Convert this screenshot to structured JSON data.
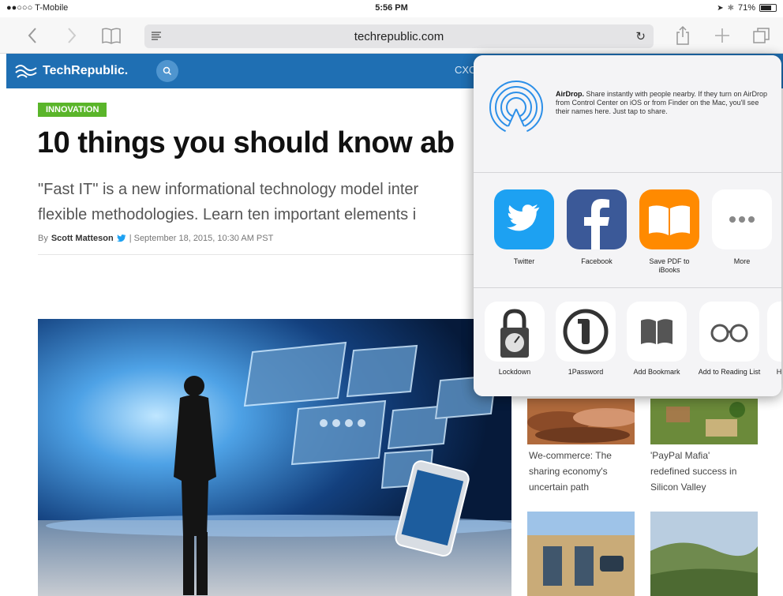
{
  "status_bar": {
    "carrier": "●●○○○ T-Mobile",
    "time": "5:56 PM",
    "battery": "71%",
    "battery_level": 0.71
  },
  "toolbar": {
    "url": "techrepublic.com",
    "icons": [
      "back-icon",
      "forward-icon",
      "bookmarks-icon",
      "reader-icon",
      "reload-icon",
      "share-icon",
      "new-tab-icon",
      "tabs-icon"
    ]
  },
  "site": {
    "logo": "TechRepublic.",
    "nav_partial": "CXO"
  },
  "article": {
    "category": "INNOVATION",
    "headline": "10 things you should know ab",
    "dek_line1": "\"Fast IT\" is a new informational technology model inter",
    "dek_line2": "flexible methodologies. Learn ten important elements i",
    "byline_prefix": "By",
    "author": "Scott Matteson",
    "date": "| September 18, 2015, 10:30 AM PST"
  },
  "side_cards": [
    {
      "title_l1": "We-commerce: The",
      "title_l2": "sharing economy's",
      "title_l3": "uncertain path"
    },
    {
      "title_l1": "'PayPal Mafia'",
      "title_l2": "redefined success in",
      "title_l3": "Silicon Valley"
    }
  ],
  "share_sheet": {
    "airdrop_title": "AirDrop.",
    "airdrop_body": " Share instantly with people nearby. If they turn on AirDrop from Control Center on iOS or from Finder on the Mac, you'll see their names here. Just tap to share.",
    "apps": [
      {
        "label": "Twitter"
      },
      {
        "label": "Facebook"
      },
      {
        "label": "Save PDF to iBooks"
      },
      {
        "label": "More"
      }
    ],
    "actions": [
      {
        "label": "Lockdown"
      },
      {
        "label": "1Password"
      },
      {
        "label": "Add Bookmark"
      },
      {
        "label": "Add to Reading List"
      },
      {
        "label": "H"
      }
    ]
  },
  "colors": {
    "header_blue": "#1f6fb3",
    "tag_green": "#5ab52a",
    "twitter_blue": "#1da1f2",
    "facebook_blue": "#3b5998",
    "ibooks_orange": "#ff8a00"
  }
}
